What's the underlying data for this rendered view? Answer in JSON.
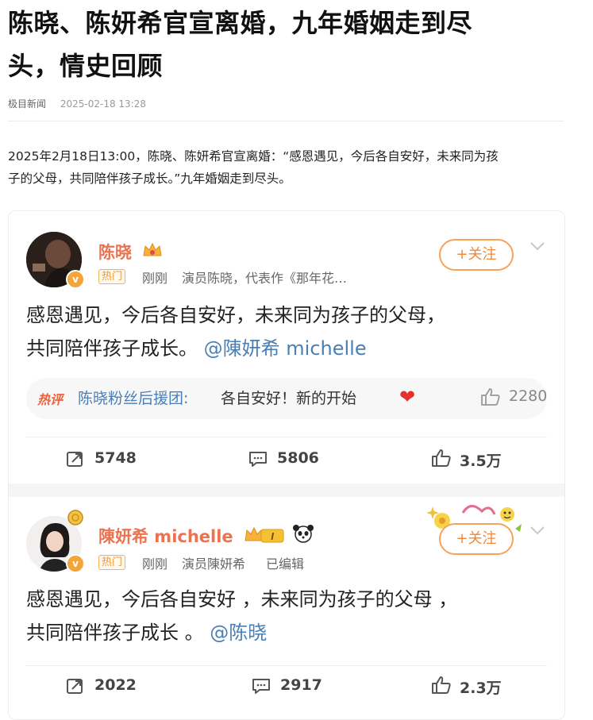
{
  "article": {
    "title_line1": "陈晓、陈妍希官宣离婚，九年婚姻走到尽",
    "title_line2": "头，情史回顾",
    "source": "极目新闻",
    "date": "2025-02-18 13:28",
    "lead_line1": "2025年2月18日13:00，陈晓、陈妍希官宣离婚：“感恩遇见，今后各自安好，未来同为孩",
    "lead_line2": "子的父母，共同陪伴孩子成长。”九年婚姻走到尽头。"
  },
  "posts": [
    {
      "user": "陈晓",
      "hot_tag": "热门",
      "time": "刚刚",
      "desc": "演员陈晓，代表作《那年花…",
      "follow": "+关注",
      "text_line1": "感恩遇见，今后各自安好，未来同为孩子的父母，",
      "text_line2_prefix": "共同陪伴孩子成长。",
      "mention": "@陳妍希 michelle",
      "hot_comment": {
        "label": "热评",
        "user": "陈晓粉丝后援团:",
        "text": "各自安好！新的开始",
        "likes": "2280"
      },
      "reposts": "5748",
      "comments": "5806",
      "likes": "3.5万"
    },
    {
      "user": "陳妍希 michelle",
      "level": "I",
      "hot_tag": "热门",
      "time": "刚刚",
      "desc": "演员陳妍希",
      "edited": "已编辑",
      "follow": "+关注",
      "text_line1": "感恩遇见，今后各自安好 ，未来同为孩子的父母 ，",
      "text_line2_prefix": "共同陪伴孩子成长 。",
      "mention": "@陈晓",
      "reposts": "2022",
      "comments": "2917",
      "likes": "2.3万"
    }
  ],
  "colors": {
    "accent_orange": "#eb7350",
    "link_blue": "#4a7fb5",
    "hot_red": "#f0603a"
  }
}
